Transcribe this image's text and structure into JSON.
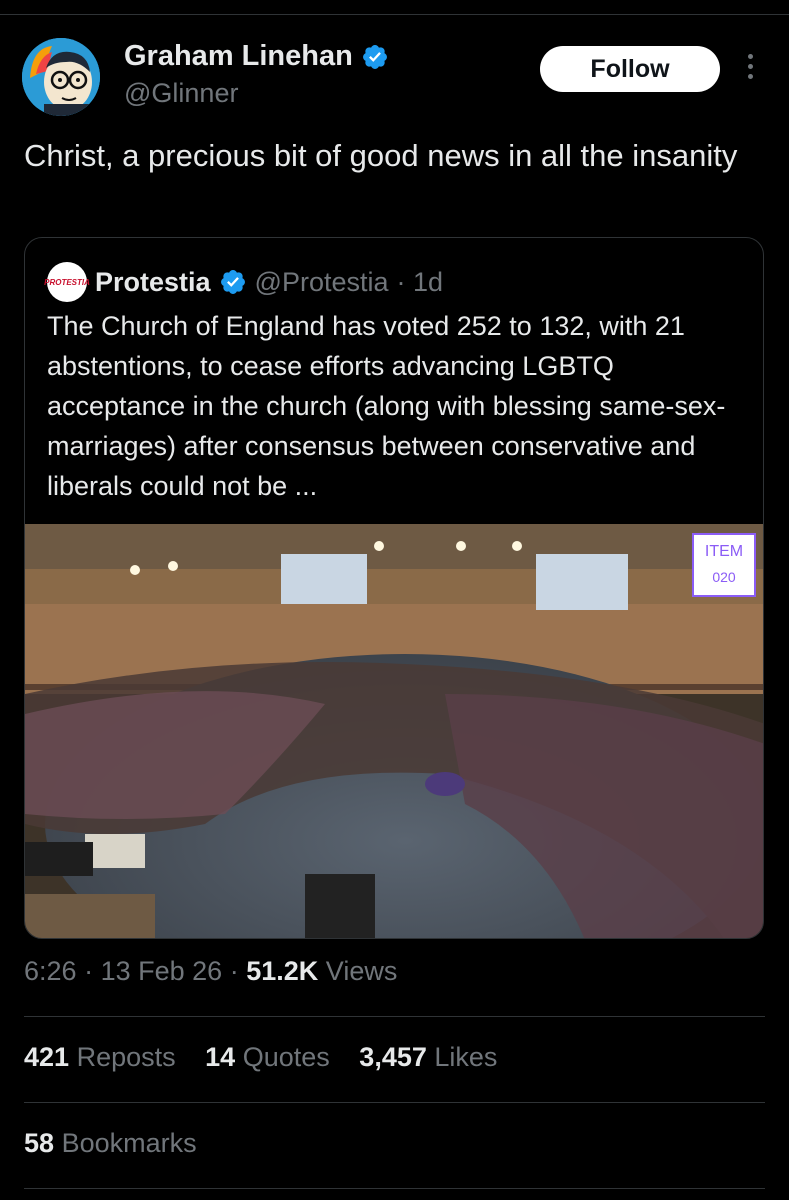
{
  "author": {
    "name": "Graham Linehan",
    "handle": "@Glinner",
    "verified": true
  },
  "follow_label": "Follow",
  "tweet_text": "Christ, a precious bit of good news in all the insanity",
  "quote": {
    "avatar_text": "PROTESTIA",
    "name": "Protestia",
    "handle": "@Protestia",
    "time": "· 1d",
    "text": "The Church of England has voted 252 to 132, with 21 abstentions, to cease efforts advancing LGBTQ acceptance in the church (along with blessing same-sex-marriages) after consensus between conservative and liberals could not be ...",
    "image": {
      "sign_line1": "ITEM",
      "sign_line2": "020"
    }
  },
  "meta": {
    "time": "6:26",
    "date": "13 Feb 26",
    "views_count": "51.2K",
    "views_label": "Views"
  },
  "stats": {
    "reposts_count": "421",
    "reposts_label": "Reposts",
    "quotes_count": "14",
    "quotes_label": "Quotes",
    "likes_count": "3,457",
    "likes_label": "Likes",
    "bookmarks_count": "58",
    "bookmarks_label": "Bookmarks"
  },
  "colors": {
    "background": "#000000",
    "text": "#e7e9ea",
    "muted": "#71767b",
    "verified": "#1d9bf0",
    "border": "#2f3336"
  },
  "icons": [
    "verified-badge-icon",
    "more-options-icon"
  ]
}
